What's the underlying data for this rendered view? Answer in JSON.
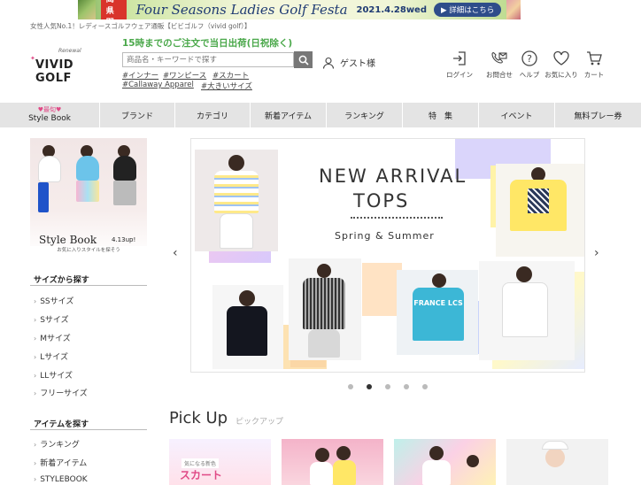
{
  "promo": {
    "tag": "福岡県開催",
    "title": "Four Seasons Ladies Golf Festa",
    "date": "2021.4.28wed",
    "button": "▶ 詳細はこちら"
  },
  "header": {
    "tagline": "女性人気No.1！レディースゴルフウェア通販【ビビゴルフ（vivid golf）】",
    "logo_small": "Renewal",
    "logo_name": "VIVID GOLF",
    "ship_note": "15時までのご注文で当日出荷(日祝除く)",
    "search_placeholder": "商品名・キーワードで探す",
    "keywords": [
      "#インナー",
      "#ワンピース",
      "#スカート",
      "#Callaway Apparel",
      "#大きいサイズ"
    ],
    "guest": "ゲスト様",
    "icons": [
      {
        "icon": "login-icon",
        "label": "ログイン"
      },
      {
        "icon": "contact-icon",
        "label": "お問合せ"
      },
      {
        "icon": "help-icon",
        "label": "ヘルプ"
      },
      {
        "icon": "heart-icon",
        "label": "お気に入り"
      },
      {
        "icon": "cart-icon",
        "label": "カート"
      }
    ]
  },
  "nav": {
    "stylebook_top": "♥最旬♥",
    "stylebook": "Style Book",
    "items": [
      "ブランド",
      "カテゴリ",
      "新着アイテム",
      "ランキング",
      "特　集",
      "イベント",
      "無料プレー券"
    ]
  },
  "sidebar": {
    "banner_title": "Style Book",
    "banner_date": "4.13up!",
    "banner_foot": "お気に入りスタイルを探そう",
    "size_title": "サイズから探す",
    "sizes": [
      "SSサイズ",
      "Sサイズ",
      "Mサイズ",
      "Lサイズ",
      "LLサイズ",
      "フリーサイズ"
    ],
    "item_title": "アイテムを探す",
    "items": [
      "ランキング",
      "新着アイテム",
      "STYLEBOOK"
    ]
  },
  "carousel": {
    "title_line1": "NEW ARRIVAL",
    "title_line2": "TOPS",
    "subtitle": "Spring & Summer",
    "shirt_text": "FRANCE LCS",
    "slide_count": 5,
    "active_slide": 2
  },
  "pickup": {
    "title": "Pick Up",
    "subtitle": "ピックアップ",
    "tile1_small": "気になる新色",
    "tile1_label": "スカート"
  },
  "colors": {
    "accent_green": "#4aa84a",
    "nav_bg": "#e4e4e4",
    "promo_red": "#d9342b",
    "promo_navy": "#1f3b73"
  }
}
